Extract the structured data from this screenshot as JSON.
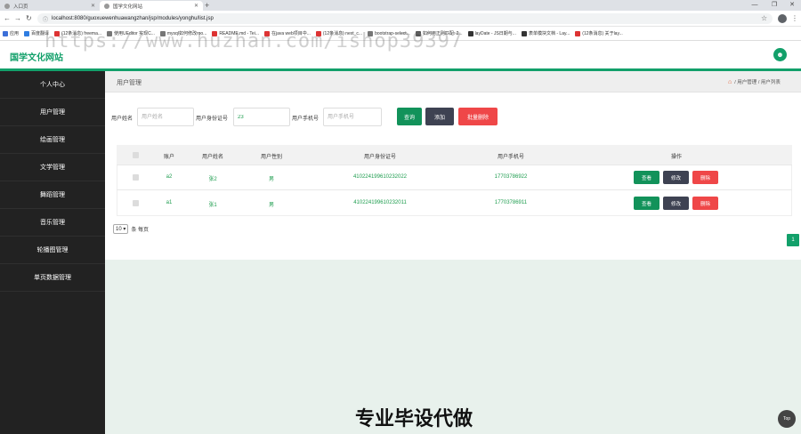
{
  "browser": {
    "tabs": [
      {
        "label": "入口页",
        "active": false
      },
      {
        "label": "国学文化网站",
        "active": true
      }
    ],
    "url": "localhost:8080/guoxuewenhuawangzhan/jsp/modules/yonghu/list.jsp",
    "bookmarks": [
      {
        "label": "应用",
        "color": "#3b6fd8"
      },
      {
        "label": "百度翻译",
        "color": "#2f7de1"
      },
      {
        "label": "(12条消息) freema...",
        "color": "#d33"
      },
      {
        "label": "使用UEditor 实现C...",
        "color": "#777"
      },
      {
        "label": "mysql如何修改roo...",
        "color": "#777"
      },
      {
        "label": "README.md - Tei...",
        "color": "#d33"
      },
      {
        "label": "在java web项目中...",
        "color": "#d33"
      },
      {
        "label": "(12条消息) next_c...",
        "color": "#d33"
      },
      {
        "label": "bootstrap-select...",
        "color": "#777"
      },
      {
        "label": "如何用正则匹配: 2...",
        "color": "#555"
      },
      {
        "label": "layDate - JS日期与...",
        "color": "#333"
      },
      {
        "label": "表单模块文档 - Lay...",
        "color": "#333"
      },
      {
        "label": "(12条消息) 关于lay...",
        "color": "#d33"
      }
    ]
  },
  "header": {
    "logo": "国学文化网站",
    "user_icon": "user-icon"
  },
  "sidebar": {
    "items": [
      {
        "label": "个人中心"
      },
      {
        "label": "用户管理"
      },
      {
        "label": "绘画管理"
      },
      {
        "label": "文学管理"
      },
      {
        "label": "舞蹈管理"
      },
      {
        "label": "音乐管理"
      },
      {
        "label": "轮播图管理"
      },
      {
        "label": "单页数据管理"
      }
    ]
  },
  "breadcrumb": {
    "title": "用户管理",
    "path": "/ 用户管理 / 用户列表"
  },
  "filters": {
    "name_label": "用户姓名",
    "name_placeholder": "用户姓名",
    "id_label": "用户身份证号",
    "id_value": "23",
    "phone_label": "用户手机号",
    "phone_placeholder": "用户手机号",
    "search_label": "查询",
    "add_label": "添加",
    "batch_delete_label": "批量删除"
  },
  "table": {
    "headers": [
      "账户",
      "用户姓名",
      "用户性别",
      "用户身份证号",
      "用户手机号",
      "操作"
    ],
    "rows": [
      {
        "account": "a2",
        "name": "张2",
        "gender": "男",
        "idcard": "410224199610232022",
        "phone": "17703786922"
      },
      {
        "account": "a1",
        "name": "张1",
        "gender": "男",
        "idcard": "410224199610232011",
        "phone": "17703786911"
      }
    ],
    "actions": {
      "view": "查看",
      "edit": "修改",
      "delete": "删除"
    }
  },
  "pager": {
    "page_size": "10",
    "per_page_label": "条 每页",
    "current_page": "1"
  },
  "overlay": {
    "watermark": "https://www.huzhan.com/ishop39397",
    "banner": "专业毕设代做",
    "top_label": "Top"
  }
}
